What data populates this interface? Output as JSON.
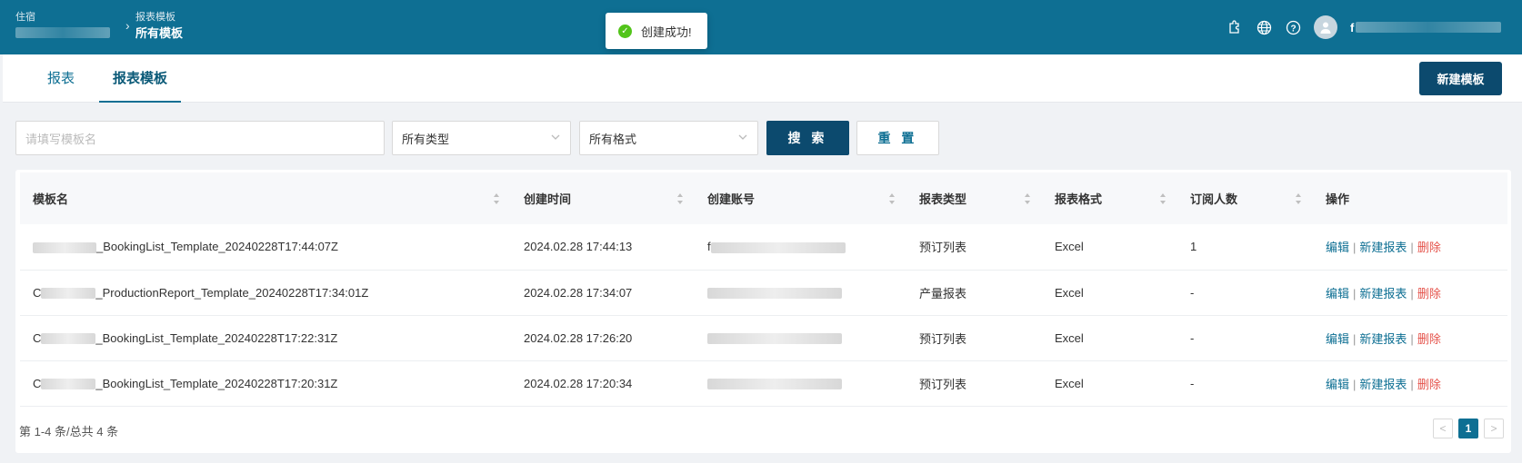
{
  "header": {
    "breadcrumb_root_label": "住宿",
    "breadcrumb_root_value": " ",
    "breadcrumb_current_parent": "报表模板",
    "breadcrumb_current": "所有模板",
    "user_name_prefix": "f",
    "icons": [
      "puzzle-icon",
      "globe-icon",
      "help-icon",
      "avatar-icon"
    ]
  },
  "toast": {
    "message": "创建成功!"
  },
  "tabs": [
    {
      "label": "报表",
      "active": false
    },
    {
      "label": "报表模板",
      "active": true
    }
  ],
  "new_template_button": "新建模板",
  "filters": {
    "name_placeholder": "请填写模板名",
    "type_value": "所有类型",
    "format_value": "所有格式",
    "search_button": "搜 索",
    "reset_button": "重 置"
  },
  "table": {
    "columns": [
      "模板名",
      "创建时间",
      "创建账号",
      "报表类型",
      "报表格式",
      "订阅人数",
      "操作"
    ],
    "rows": [
      {
        "name": "_BookingList_Template_20240228T17:44:07Z",
        "name_prefix": "",
        "created": "2024.02.28 17:44:13",
        "account_prefix": "f",
        "type": "预订列表",
        "format": "Excel",
        "subscribers": "1"
      },
      {
        "name": "_ProductionReport_Template_20240228T17:34:01Z",
        "name_prefix": "C",
        "created": "2024.02.28 17:34:07",
        "account_prefix": "",
        "type": "产量报表",
        "format": "Excel",
        "subscribers": "-"
      },
      {
        "name": "_BookingList_Template_20240228T17:22:31Z",
        "name_prefix": "C",
        "created": "2024.02.28 17:26:20",
        "account_prefix": "",
        "type": "预订列表",
        "format": "Excel",
        "subscribers": "-"
      },
      {
        "name": "_BookingList_Template_20240228T17:20:31Z",
        "name_prefix": "C",
        "created": "2024.02.28 17:20:34",
        "account_prefix": "",
        "type": "预订列表",
        "format": "Excel",
        "subscribers": "-"
      }
    ],
    "actions": {
      "edit": "编辑",
      "new_report": "新建报表",
      "delete": "删除",
      "separator": "|"
    }
  },
  "footer": {
    "count_text": "第 1-4 条/总共 4 条"
  },
  "pagination": {
    "prev": "<",
    "current": "1",
    "next": ">"
  },
  "colors": {
    "header_bg": "#0e6f93",
    "primary_dark": "#0c4a6e",
    "link": "#0e6f93",
    "danger": "#e5534b",
    "success": "#52c41a"
  }
}
